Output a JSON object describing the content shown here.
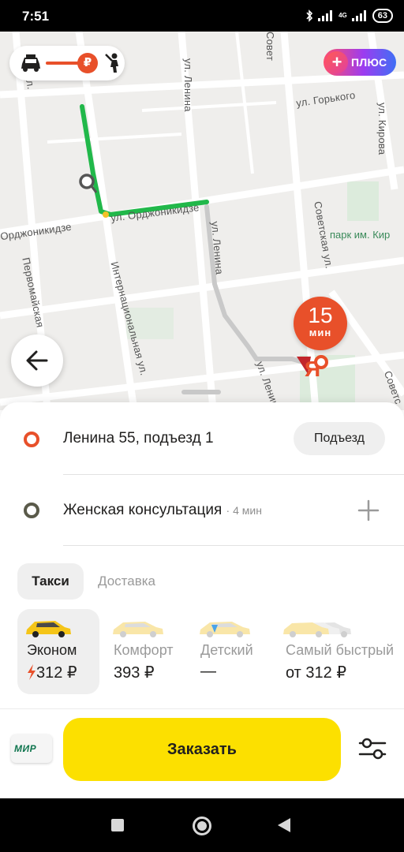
{
  "status_bar": {
    "time": "7:51",
    "network_label": "4G",
    "battery": "63"
  },
  "map": {
    "streets": {
      "lenina_top": "ул. Ленина",
      "lenina_mid": "ул. Ленина",
      "lenina_bottom": "ул. Ленина",
      "ordzhonikidze_left": "Орджоникидзе",
      "ordzhonikidze_right": "ул. Орджоникидзе",
      "gorkogo": "ул. Горького",
      "kirova": "ул. Кирова",
      "sovetskaya_mid": "Советская ул.",
      "sovetskaya_right": "Советс",
      "internatsionalnaya": "Интернациональная ул.",
      "pervomayskaya": "Первомайская",
      "sovets_top": "Совет",
      "ul_top": "ул."
    },
    "park_label": "парк им. Кир",
    "plus_badge": "ПЛЮС",
    "eta": {
      "value": "15",
      "unit": "мин"
    },
    "destination_logo": "Я"
  },
  "route": {
    "from": {
      "address": "Ленина 55, подъезд 1",
      "chip": "Подъезд",
      "dot_color": "#e8502a"
    },
    "to": {
      "address": "Женская консультация",
      "suffix": "· 4 мин",
      "dot_color": "#5a5a4a"
    }
  },
  "tabs": [
    {
      "label": "Такси",
      "active": true
    },
    {
      "label": "Доставка",
      "active": false
    }
  ],
  "tariffs": [
    {
      "name": "Эконом",
      "price": "312 ₽",
      "surge": true,
      "active": true
    },
    {
      "name": "Комфорт",
      "price": "393 ₽",
      "active": false
    },
    {
      "name": "Детский",
      "price": "—",
      "active": false
    },
    {
      "name": "Самый быстрый",
      "price": "от 312 ₽",
      "active": false
    }
  ],
  "payment": {
    "card": "МИР"
  },
  "order_button": "Заказать",
  "colors": {
    "accent_yellow": "#fce000",
    "route_green": "#21b84a",
    "eta_orange": "#e8502a"
  }
}
